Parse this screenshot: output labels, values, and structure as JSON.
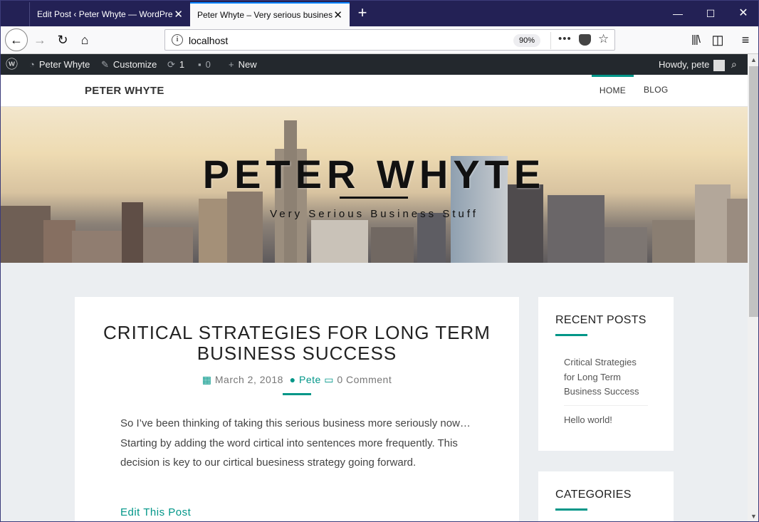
{
  "browser": {
    "tabs": [
      {
        "title": "Edit Post ‹ Peter Whyte — WordPress",
        "active": false
      },
      {
        "title": "Peter Whyte – Very serious business",
        "active": true
      }
    ],
    "new_tab_icon": "plus-icon",
    "url": "localhost",
    "zoom": "90%",
    "window_controls": {
      "minimize": "minimize-icon",
      "maximize": "maximize-icon",
      "close": "close-icon"
    }
  },
  "admin_bar": {
    "site_name": "Peter Whyte",
    "customize": "Customize",
    "updates_count": "1",
    "comments_count": "0",
    "new": "New",
    "howdy": "Howdy, pete"
  },
  "site": {
    "brand": "PETER WHYTE",
    "menu": [
      "HOME",
      "BLOG"
    ],
    "hero_title": "PETER WHYTE",
    "hero_subtitle": "Very Serious Business Stuff"
  },
  "post": {
    "title": "CRITICAL STRATEGIES FOR LONG TERM BUSINESS SUCCESS",
    "date": "March 2, 2018",
    "author": "Pete",
    "comments": "0 Comment",
    "body": "So I’ve been thinking of taking this serious business more seriously now… Starting by adding the word cirtical into sentences more frequently. This decision is key to our cirtical buesiness strategy going forward.",
    "edit_link": "Edit This Post"
  },
  "sidebar": {
    "recent_posts": {
      "title": "RECENT POSTS",
      "items": [
        "Critical Strategies for Long Term Business Success",
        "Hello world!"
      ]
    },
    "categories": {
      "title": "CATEGORIES"
    }
  },
  "colors": {
    "accent": "#009688",
    "admin_bar": "#23282d",
    "tab_strip": "#232155"
  }
}
